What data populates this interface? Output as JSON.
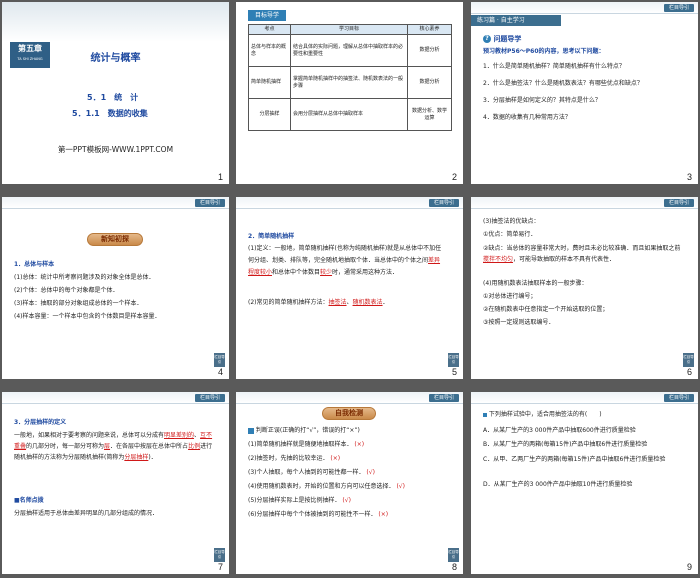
{
  "slides": [
    {
      "page": "1",
      "chapter_badge": "第五章",
      "chapter_sub": "TA SHI ZHANG",
      "title": "统计与概率",
      "section1": "5．1　统　计",
      "section2": "5．1.1　数据的收集",
      "footer": "第一PPT模板网-WWW.1PPT.COM"
    },
    {
      "page": "2",
      "tab": "目标导学",
      "headers": [
        "考点",
        "学习目标",
        "核心素养"
      ],
      "rows": [
        [
          "总体与样本的概念",
          "结合具体的实际问题，理解从总体中抽取样本的必要性和重要性",
          "数据分析"
        ],
        [
          "简单随机抽样",
          "掌握简单随机抽样中的抽签法、随机数表法的一般步骤",
          "数据分析"
        ],
        [
          "分层抽样",
          "会用分层抽样从总体中抽取样本",
          "数据分析、数学运算"
        ]
      ]
    },
    {
      "page": "3",
      "header_tag": "栏目导引",
      "tab": "练习篇 · 自主学习",
      "subtitle": "问题导学",
      "intro": "预习教材P56～P60的内容，思考以下问题：",
      "questions": [
        "1．什么是简单随机抽样？简单随机抽样有什么特点？",
        "2．什么是抽签法？什么是随机数表法？有哪些优点和缺点？",
        "3．分层抽样是如何定义的？其特点是什么？",
        "4．数据的收集有几种常用方法？"
      ]
    },
    {
      "page": "4",
      "header_tag": "栏目导引",
      "badge": "新知初探",
      "heading": "1．总体与样本",
      "lines": [
        "(1)总体：统计中所考察问题涉及的对象全体是总体．",
        "(2)个体：总体中的每个对象都是个体．",
        "(3)样本：抽取的部分对象组成总体的一个样本．",
        "(4)样本容量：一个样本中包含的个体数目是样本容量．"
      ],
      "corner": "栏目导引"
    },
    {
      "page": "5",
      "header_tag": "栏目导引",
      "heading": "2．简单随机抽样",
      "body1": "(1)定义：一般地，简单随机抽样(也称为纯随机抽样)就是从总体中不加任何分组、划类、排队等，完全随机地抽取个体．当总体中的个体之间",
      "fill1": "差异程度较小",
      "body2": "和总体中个体数目",
      "fill2": "较少",
      "body3": "时，通常采用这种方法．",
      "body4": "(2)常见的简单随机抽样方法：",
      "fill3": "抽签法",
      "sep": "、",
      "fill4": "随机数表法",
      "end": "．",
      "corner": "栏目导引"
    },
    {
      "page": "6",
      "header_tag": "栏目导引",
      "l1": "(3)抽签法的优缺点：",
      "l2": "①优点：简单易行．",
      "l3a": "②缺点：当总体的容量非常大时，费时且未必比较准确．而且如果抽取之前",
      "l3fill": "搅拌不均匀",
      "l3b": "，可能导致抽取的样本不具有代表性．",
      "l4": "(4)用随机数表法抽取样本的一般步骤：",
      "l5": "①对总体进行编号；",
      "l6": "②在随机数表中任意指定一个开始选取的位置；",
      "l7": "③按照一定规则选取编号．",
      "corner": "栏目导引"
    },
    {
      "page": "7",
      "header_tag": "栏目导引",
      "heading": "3．分层抽样的定义",
      "b1": "一般地，如果相对于要考察的问题来说，总体可以分成有",
      "f1": "明显差别的",
      "b2": "、",
      "f2": "互不重叠",
      "b3": "的几部分时，每一部分可称为",
      "f3": "层",
      "b4": "．在各层中按层在总体中所占",
      "f4": "比例",
      "b5": "进行随机抽样的方法称为分层随机抽样(简称为",
      "f5": "分层抽样",
      "b6": ")．",
      "note_title": "■名师点拨",
      "note": "分层抽样适用于总体由差异明显的几部分组成的情况．",
      "corner": "栏目导引"
    },
    {
      "page": "8",
      "header_tag": "栏目导引",
      "badge": "自我检测",
      "prompt": "判断正误(正确的打“√”，错误的打“×”)",
      "items": [
        {
          "text": "(1)简单随机抽样就是随便地抽取样本．",
          "mark": "(×)"
        },
        {
          "text": "(2)抽签时，先抽的比较幸运．",
          "mark": "(×)"
        },
        {
          "text": "(3)个人抽取，每个人抽到的可能性都一样．",
          "mark": "(√)"
        },
        {
          "text": "(4)使用随机数表时，开始的位置和方向可以任意选择．",
          "mark": "(√)"
        },
        {
          "text": "(5)分层抽样实际上是按比例抽样．",
          "mark": "(√)"
        },
        {
          "text": "(6)分层抽样中每个个体被抽到的可能性不一样．",
          "mark": "(×)"
        }
      ],
      "corner": "栏目导引"
    },
    {
      "page": "9",
      "header_tag": "栏目导引",
      "question": "下列抽样试验中，适合用抽签法的有(　　)",
      "options": [
        "A．从某厂生产的3 000件产品中抽取600件进行质量检验",
        "B．从某厂生产的两箱(每箱15件)产品中抽取6件进行质量检验",
        "C．从甲、乙两厂生产的两箱(每箱15件)产品中抽取6件进行质量检验",
        "D．从某厂生产的3 000件产品中抽取10件进行质量检验"
      ]
    }
  ]
}
